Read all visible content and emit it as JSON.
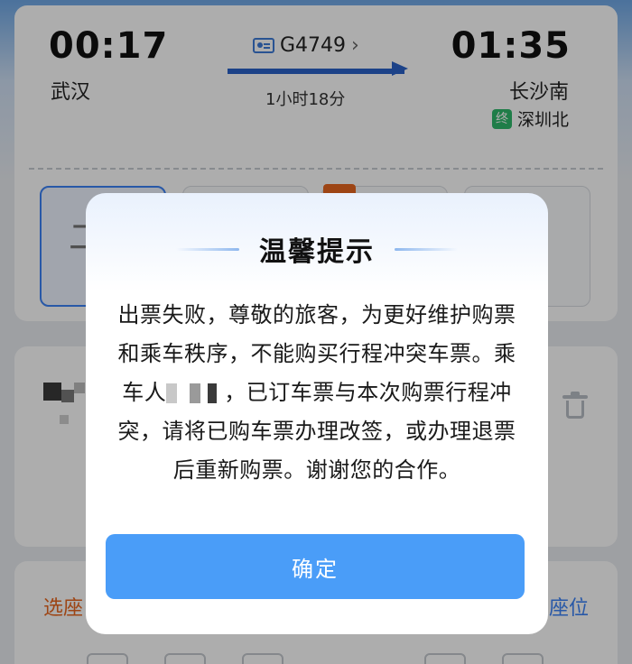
{
  "train": {
    "departure_time": "00:17",
    "arrival_time": "01:35",
    "departure_station": "武汉",
    "arrival_station": "长沙南",
    "terminal_badge": "终",
    "terminal_station": "深圳北",
    "train_number": "G4749",
    "train_number_chevron": "›",
    "duration": "1小时18分"
  },
  "seat_classes": {
    "first_glyph": "二"
  },
  "seat_selection": {
    "left_label": "选座",
    "right_label": "座位"
  },
  "modal": {
    "title": "温馨提示",
    "message_part1": "出票失败，尊敬的旅客，为更好维护购票和乘车秩序，不能购买行程冲突车票。乘车人",
    "message_part2": "，已订车票与本次购票行程冲突，请将已购车票办理改签，或办理退票后重新购票。谢谢您的合作。",
    "confirm_label": "确定"
  },
  "colors": {
    "accent_blue": "#4a9df8",
    "orange": "#e8661f",
    "terminal_green": "#2fb86b"
  }
}
